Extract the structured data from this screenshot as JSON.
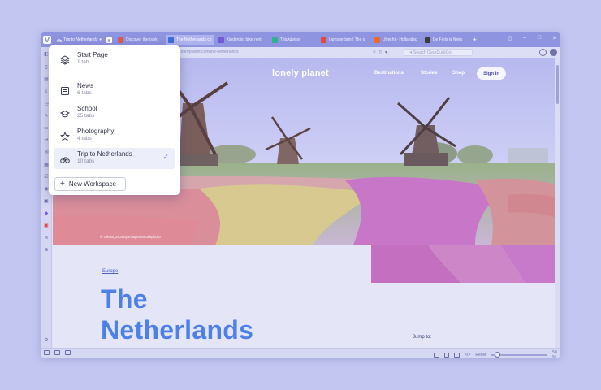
{
  "window": {
    "workspace_switcher_label": "Trip to Netherlands",
    "tabs": [
      {
        "label": "Discover the park",
        "favicon_color": "#e05a4b"
      },
      {
        "label": "The Netherlands co",
        "favicon_color": "#3f6fd8",
        "active": true
      },
      {
        "label": "Kinderdijd bike rent",
        "favicon_color": "#6d5ad8"
      },
      {
        "label": "TripAdvisor",
        "favicon_color": "#2fb38a"
      },
      {
        "label": "I amsterdam | The o",
        "favicon_color": "#e3483f"
      },
      {
        "label": "Utrecht - Hollandsc",
        "favicon_color": "#e86a2c"
      },
      {
        "label": "De Fiets is Niets",
        "favicon_color": "#3b3b3b"
      }
    ],
    "new_tab_label": "+"
  },
  "address_bar": {
    "url": "lonelyplanet.com/the-netherlands",
    "search_placeholder": "Search DuckDuckGo"
  },
  "website": {
    "logo": "lonely planet",
    "nav": [
      "Destinations",
      "Stories",
      "Shop"
    ],
    "signin_label": "Sign In",
    "photo_credit": "© Olena_Z/Getty Images/iStockphoto",
    "kicker": "Europe",
    "title_line1": "The",
    "title_line2": "Netherlands",
    "jump_to": "Jump to:"
  },
  "status_bar": {
    "reset_label": "Reset",
    "zoom_value": "50 %",
    "zoom_fraction": 0.06
  },
  "workspace_popup": {
    "items": [
      {
        "title": "Start Page",
        "subtitle": "1 tab",
        "icon": "layers-icon"
      },
      {
        "title": "News",
        "subtitle": "6 tabs",
        "icon": "newspaper-icon"
      },
      {
        "title": "School",
        "subtitle": "25 tabs",
        "icon": "graduation-cap-icon"
      },
      {
        "title": "Photography",
        "subtitle": "4 tabs",
        "icon": "star-icon"
      },
      {
        "title": "Trip to Netherlands",
        "subtitle": "10 tabs",
        "icon": "bicycle-icon",
        "selected": true
      }
    ],
    "new_workspace_label": "New Workspace"
  }
}
